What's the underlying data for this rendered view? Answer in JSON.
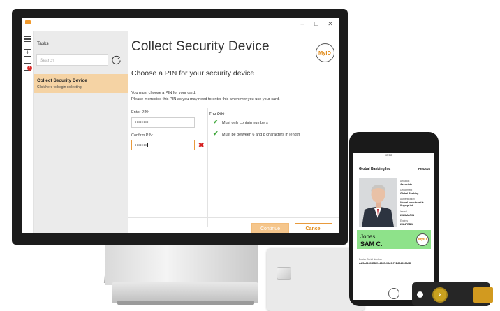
{
  "window": {
    "minimize": "–",
    "maximize": "□",
    "close": "✕"
  },
  "sidebar": {
    "title": "Tasks",
    "search_placeholder": "Search",
    "task": {
      "title": "Collect Security Device",
      "subtitle": "Click here to begin collecting"
    }
  },
  "main": {
    "title": "Collect Security Device",
    "logo": "MyID",
    "subtitle": "Choose a PIN for your security device",
    "desc1": "You must choose a PIN for your card.",
    "desc2": "Please memorise this PIN as you may need to enter this whenever you use your card.",
    "enter_pin_label": "Enter PIN:",
    "enter_pin_value": "••••••••",
    "confirm_pin_label": "Confirm PIN:",
    "confirm_pin_value": "•••••••",
    "pin_rules_title": "The PIN:",
    "rules": [
      "Must only contain numbers",
      "Must be between 6 and 8 characters in length"
    ],
    "continue_label": "Continue",
    "cancel_label": "Cancel"
  },
  "phone": {
    "time": "14:03",
    "org": "Global Banking Inc",
    "date": "FEB2024",
    "affiliation_label": "Affiliation",
    "affiliation": "Associate",
    "department_label": "Department",
    "department": "Global Banking",
    "authentication_label": "Authentication",
    "authentication": "Virtual smart card + fingerprint",
    "issued_label": "Issued",
    "issued": "2023MAR01",
    "expires_label": "Expires",
    "expires": "2024FEB28",
    "surname": "Jones",
    "given_name": "SAM C.",
    "logo": "MyID",
    "serial_label": "Device Serial Number",
    "serial": "AA5A0139-BD25-480E-9A20-72B864206A9D"
  },
  "colors": {
    "accent": "#e89a3c",
    "task_highlight": "#f5d3a4",
    "check": "#40a83c",
    "error": "#d52020",
    "name_band": "#8ee28a"
  }
}
